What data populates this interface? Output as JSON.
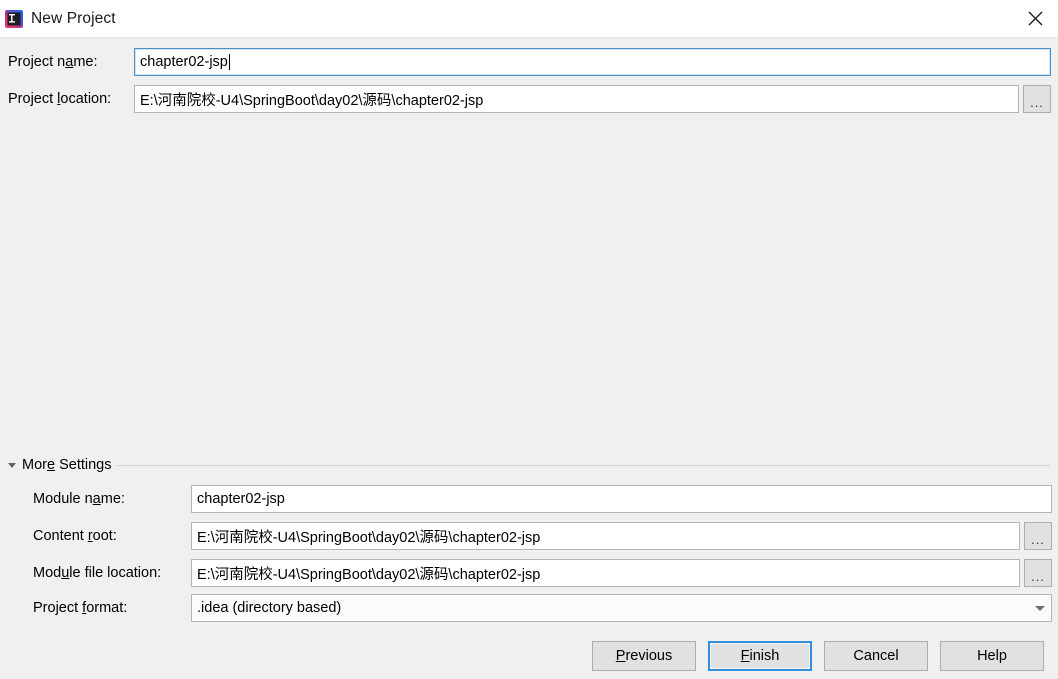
{
  "window": {
    "title": "New Project",
    "app_icon": "intellij-idea-icon",
    "close_icon": "close-icon"
  },
  "main": {
    "project_name": {
      "label_before": "Project n",
      "label_mnemonic": "a",
      "label_after": "me:",
      "value": "chapter02-jsp",
      "focused": true
    },
    "project_location": {
      "label_before": "Project ",
      "label_mnemonic": "l",
      "label_after": "ocation:",
      "value": "E:\\河南院校-U4\\SpringBoot\\day02\\源码\\chapter02-jsp",
      "browse_label": "..."
    }
  },
  "more_settings": {
    "title_before": "Mor",
    "title_mnemonic": "e",
    "title_after": " Settings",
    "expanded": true,
    "toggle_icon": "triangle-down-icon",
    "module_name": {
      "label_before": "Module n",
      "label_mnemonic": "a",
      "label_after": "me:",
      "value": "chapter02-jsp"
    },
    "content_root": {
      "label_before": "Content ",
      "label_mnemonic": "r",
      "label_after": "oot:",
      "value": "E:\\河南院校-U4\\SpringBoot\\day02\\源码\\chapter02-jsp",
      "browse_label": "..."
    },
    "module_file_location": {
      "label_before": "Mod",
      "label_mnemonic": "u",
      "label_after": "le file location:",
      "value": "E:\\河南院校-U4\\SpringBoot\\day02\\源码\\chapter02-jsp",
      "browse_label": "..."
    },
    "project_format": {
      "label_before": "Project ",
      "label_mnemonic": "f",
      "label_after": "ormat:",
      "value": ".idea (directory based)",
      "chevron_icon": "chevron-down-icon"
    }
  },
  "buttons": {
    "previous": {
      "before": "",
      "mnemonic": "P",
      "after": "revious"
    },
    "finish": {
      "before": "",
      "mnemonic": "F",
      "after": "inish",
      "is_default": true
    },
    "cancel": {
      "before": "Cancel",
      "mnemonic": "",
      "after": ""
    },
    "help": {
      "before": "Help",
      "mnemonic": "",
      "after": ""
    }
  },
  "colors": {
    "accent": "#2d8fdd",
    "dialog_bg": "#f0f0f0",
    "field_border": "#b4b4b4",
    "focus_border": "#4a90c4"
  }
}
